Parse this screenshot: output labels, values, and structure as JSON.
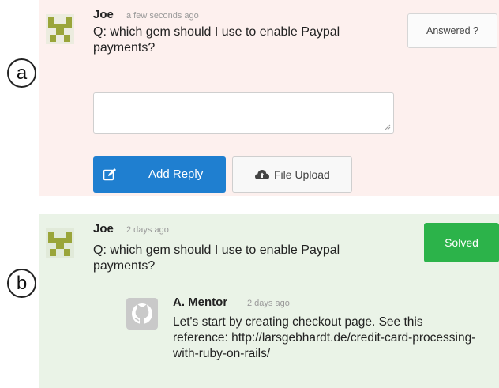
{
  "panel_a": {
    "label": "a",
    "author": "Joe",
    "time": "a few seconds ago",
    "question": "Q: which gem should I use to enable Paypal payments?",
    "answered_button": "Answered ?",
    "reply_input": {
      "value": "",
      "placeholder": ""
    },
    "add_reply_button": "Add Reply",
    "add_reply_icon": "edit-icon",
    "file_upload_button": "File Upload",
    "file_upload_icon": "cloud-upload-icon"
  },
  "panel_b": {
    "label": "b",
    "author": "Joe",
    "time": "2 days ago",
    "question": "Q: which gem should I use to enable Paypal payments?",
    "solved_button": "Solved",
    "reply": {
      "author": "A. Mentor",
      "time": "2 days ago",
      "avatar_icon": "github-octocat-icon",
      "text": "Let's start by creating checkout page. See this reference: http://larsgebhardt.de/credit-card-processing-with-ruby-on-rails/"
    }
  },
  "colors": {
    "panel_a_bg": "#fdf0ee",
    "panel_b_bg": "#eaf3e7",
    "add_reply_blue": "#1f7fd0",
    "solved_green": "#2cb34a",
    "avatar_olive": "#9aa53a"
  }
}
